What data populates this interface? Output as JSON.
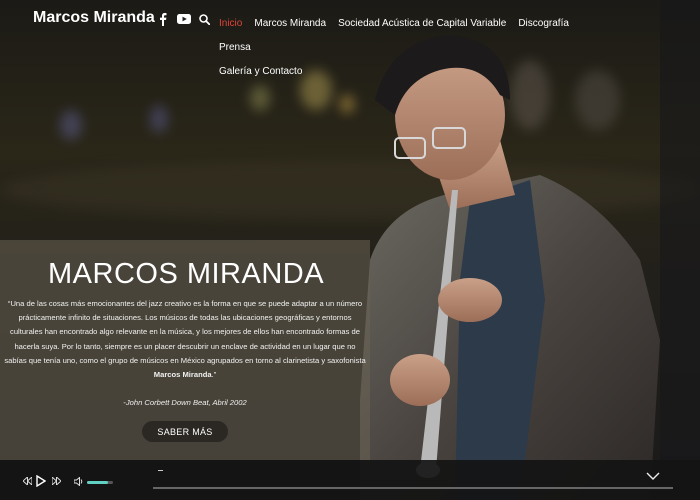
{
  "site": {
    "logo": "Marcos Miranda"
  },
  "nav": {
    "items": [
      "Inicio",
      "Marcos Miranda",
      "Sociedad Acústica de Capital Variable",
      "Discografía",
      "Prensa",
      "Galería y Contacto"
    ],
    "active_index": 0
  },
  "social": [
    "facebook-icon",
    "youtube-icon",
    "search-icon"
  ],
  "hero": {
    "title": "MARCOS MIRANDA",
    "quote_lead": "“Una de las cosas más emocionantes del jazz creativo es la forma en que se puede adaptar a un número prácticamente infinito de situaciones. Los músicos de todas las ubicaciones geográficas y entornos culturales han encontrado algo relevante en la música, y los mejores de ellos han encontrado formas de hacerla suya. Por lo tanto, siempre es un placer descubrir un enclave de actividad en un lugar que no sabías que tenía uno, como el grupo de músicos en México agrupados en torno al clarinetista y saxofonista ",
    "quote_name": "Marcos Miranda",
    "quote_end": ".”",
    "citation": "-John Corbett Down Beat, Abril 2002",
    "cta_label": "SABER MÁS"
  },
  "player": {
    "controls": [
      "previous-icon",
      "play-icon",
      "next-icon",
      "volume-icon",
      "chevron-down-icon"
    ],
    "volume_fraction": 0.8,
    "progress_fraction": 0
  },
  "colors": {
    "accent": "#e0443a",
    "volume": "#5fd0c2",
    "panel": "#696254"
  }
}
